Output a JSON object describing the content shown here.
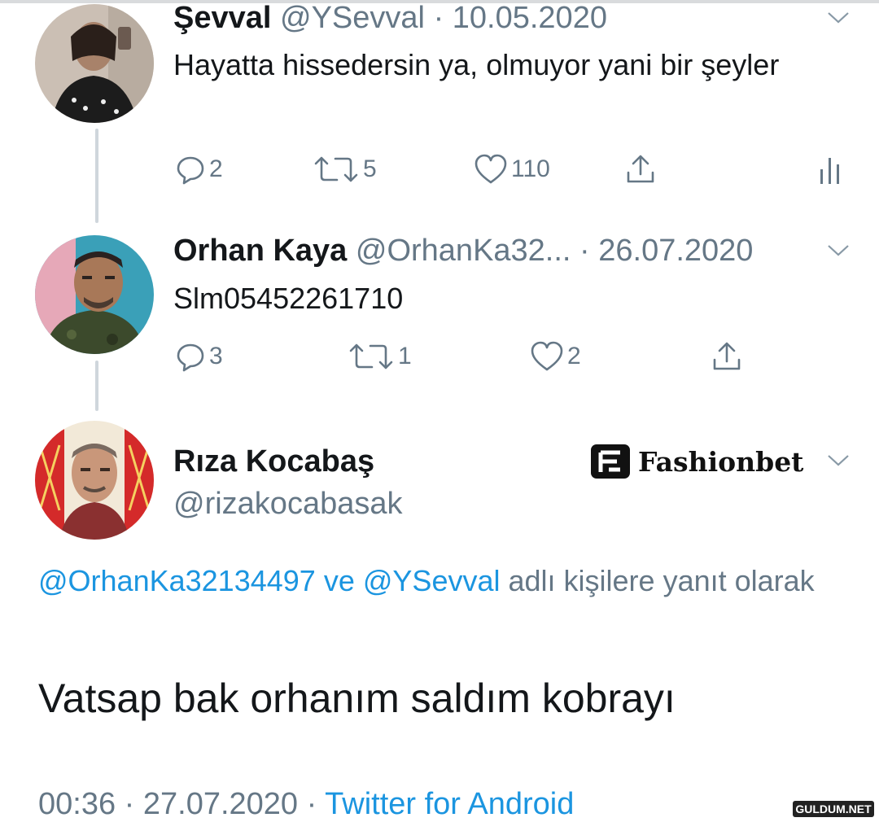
{
  "tweets": [
    {
      "name": "Şevval",
      "handle": "@YSevval",
      "date": "· 10.05.2020",
      "text": "Hayatta hissedersin ya, olmuyor yani bir şeyler",
      "replies": "2",
      "retweets": "5",
      "likes": "110"
    },
    {
      "name": "Orhan Kaya",
      "handle": "@OrhanKa32...",
      "date": "· 26.07.2020",
      "text": "Slm05452261710",
      "replies": "3",
      "retweets": "1",
      "likes": "2"
    }
  ],
  "main_tweet": {
    "name": "Rıza Kocabaş",
    "handle": "@rizakocabasak",
    "reply_handle_1": "@OrhanKa32134497",
    "reply_connector": "ve",
    "reply_handle_2": "@YSevval",
    "reply_suffix": "adlı kişilere yanıt olarak",
    "text": "Vatsap bak orhanım saldım kobrayı",
    "time": "00:36 · 27.07.2020 ·",
    "source": "Twitter for Android"
  },
  "overlay": {
    "logo_text": "Fashionbet",
    "watermark": "GULDUM.NET"
  },
  "icons": {
    "reply": "reply-icon",
    "retweet": "retweet-icon",
    "like": "heart-icon",
    "share": "share-icon",
    "analytics": "analytics-icon",
    "more": "chevron-down-icon"
  },
  "colors": {
    "link": "#1b95e0",
    "muted": "#657786",
    "text": "#14171a",
    "thread_line": "#cfd6dc"
  }
}
